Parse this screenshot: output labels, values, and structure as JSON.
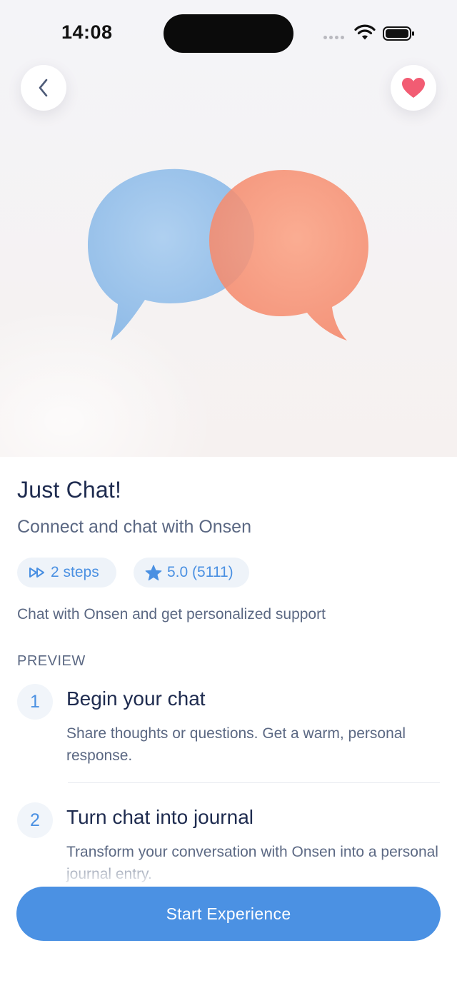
{
  "status_bar": {
    "time": "14:08"
  },
  "header": {
    "back_icon": "chevron-left-icon",
    "favorite_icon": "heart-icon"
  },
  "colors": {
    "accent": "#4b91e3",
    "favorite": "#f25c73",
    "bubble_blue": "#8fbce8",
    "bubble_orange": "#f7906f"
  },
  "experience": {
    "title": "Just Chat!",
    "subtitle": "Connect and chat with Onsen",
    "steps_chip": "2 steps",
    "rating_chip": "5.0 (5111)",
    "description": "Chat with Onsen and get personalized support"
  },
  "preview": {
    "label": "PREVIEW",
    "steps": [
      {
        "number": "1",
        "title": "Begin your chat",
        "body": "Share thoughts or questions. Get a warm, personal response."
      },
      {
        "number": "2",
        "title": "Turn chat into journal",
        "body": "Transform your conversation with Onsen into a personal journal entry."
      }
    ]
  },
  "cta": {
    "label": "Start Experience"
  }
}
